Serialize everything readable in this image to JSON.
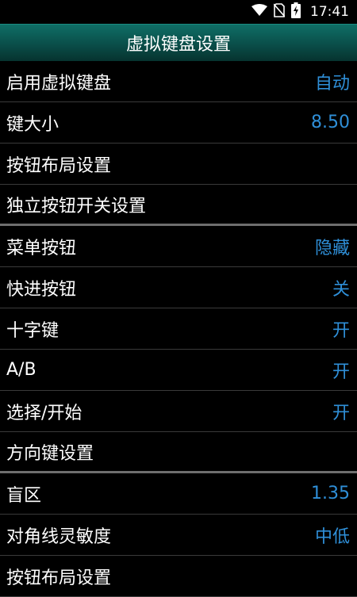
{
  "status_bar": {
    "time": "17:41",
    "icons": [
      "wifi-icon",
      "no-sim-icon",
      "battery-charging-icon"
    ]
  },
  "header": {
    "title": "虚拟键盘设置"
  },
  "settings": [
    {
      "label": "启用虚拟键盘",
      "value": "自动"
    },
    {
      "label": "键大小",
      "value": "8.50"
    },
    {
      "label": "按钮布局设置",
      "value": ""
    },
    {
      "label": "独立按钮开关设置",
      "value": ""
    },
    {
      "label": "菜单按钮",
      "value": "隐藏"
    },
    {
      "label": "快进按钮",
      "value": "关"
    },
    {
      "label": "十字键",
      "value": "开"
    },
    {
      "label": "A/B",
      "value": "开"
    },
    {
      "label": "选择/开始",
      "value": "开"
    },
    {
      "label": "方向键设置",
      "value": ""
    },
    {
      "label": "盲区",
      "value": "1.35"
    },
    {
      "label": "对角线灵敏度",
      "value": "中低"
    },
    {
      "label": "按钮布局设置",
      "value": ""
    }
  ],
  "colors": {
    "accent_value": "#2f8fd8",
    "title_bar": "#0a4e49",
    "background": "#000000"
  }
}
